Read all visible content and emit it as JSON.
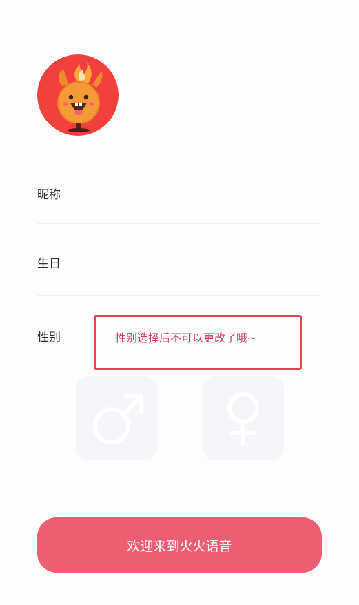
{
  "app_name": "火火语音",
  "avatar": {
    "icon": "flame-mascot-icon",
    "bg_color": "#f2403c"
  },
  "form": {
    "nickname": {
      "label": "昵称",
      "value": "",
      "placeholder": ""
    },
    "birthday": {
      "label": "生日",
      "value": "",
      "placeholder": ""
    },
    "gender": {
      "label": "性别",
      "tooltip": "性别选择后不可以更改了哦~",
      "options": [
        {
          "icon": "male-symbol-icon"
        },
        {
          "icon": "female-symbol-icon"
        }
      ]
    }
  },
  "submit_button": {
    "label": "欢迎来到火火语音",
    "color": "#ee5e73"
  },
  "colors": {
    "tooltip_border": "#e4454c",
    "tooltip_text": "#d24062"
  }
}
